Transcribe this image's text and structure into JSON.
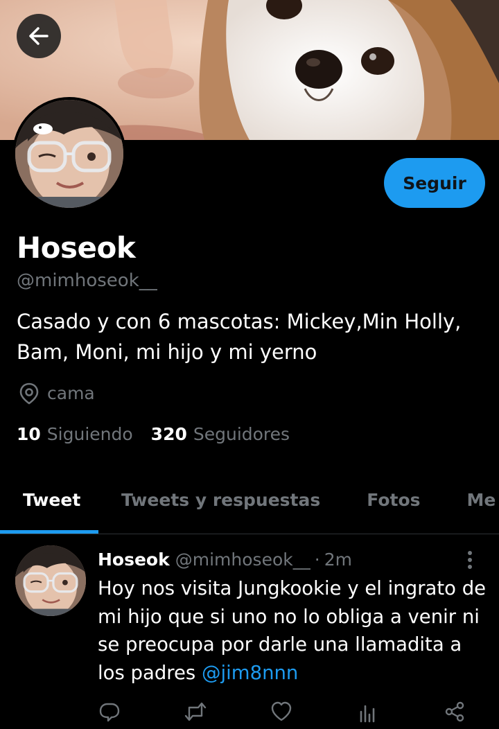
{
  "header": {
    "back_icon": "arrow-left-icon"
  },
  "profile": {
    "display_name": "Hoseok",
    "handle": "@mimhoseok__",
    "follow_label": "Seguir",
    "bio": "Casado y con 6 mascotas: Mickey,Min Holly, Bam, Moni, mi hijo y mi yerno",
    "location": "cama",
    "location_icon": "location-pin-icon",
    "following_count": "10",
    "following_label": "Siguiendo",
    "followers_count": "320",
    "followers_label": "Seguidores"
  },
  "tabs": [
    {
      "label": "Tweet",
      "active": true
    },
    {
      "label": "Tweets y respuestas",
      "active": false
    },
    {
      "label": "Fotos",
      "active": false
    },
    {
      "label": "Me gusta",
      "active": false
    }
  ],
  "tweet": {
    "name": "Hoseok",
    "handle": "@mimhoseok__",
    "separator": "·",
    "time": "2m",
    "text": "Hoy nos visita Jungkookie y el ingrato de mi hijo que si uno no lo obliga a venir ni se preocupa por darle una llamadita a los padres ",
    "mention": "@jim8nnn",
    "actions": [
      "reply-icon",
      "retweet-icon",
      "like-icon",
      "analytics-icon",
      "share-icon"
    ]
  },
  "colors": {
    "background": "#000000",
    "accent": "#1d9bf0",
    "secondary_text": "#71767b",
    "divider": "#2f3336"
  }
}
